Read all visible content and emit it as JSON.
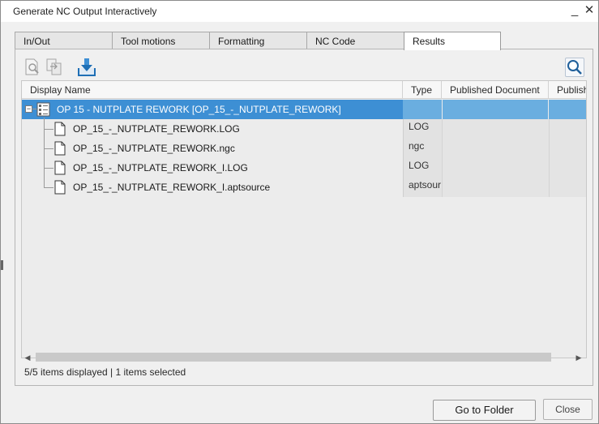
{
  "window": {
    "title": "Generate NC Output Interactively",
    "minimize_glyph": "_",
    "close_glyph": "✕"
  },
  "tabs": [
    {
      "label": "In/Out",
      "active": false
    },
    {
      "label": "Tool motions",
      "active": false
    },
    {
      "label": "Formatting",
      "active": false
    },
    {
      "label": "NC Code",
      "active": false
    },
    {
      "label": "Results",
      "active": true
    }
  ],
  "toolbar": {
    "icons": [
      "preview-document-icon",
      "compare-documents-icon",
      "save-download-icon",
      "search-icon"
    ]
  },
  "grid": {
    "columns": [
      "Display Name",
      "Type",
      "Published Document",
      "Publish"
    ],
    "root": {
      "label": "OP 15 - NUTPLATE REWORK [OP_15_-_NUTPLATE_REWORK]",
      "expand_glyph": "−",
      "selected": true
    },
    "rows": [
      {
        "name": "OP_15_-_NUTPLATE_REWORK.LOG",
        "type": "LOG"
      },
      {
        "name": "OP_15_-_NUTPLATE_REWORK.ngc",
        "type": "ngc"
      },
      {
        "name": "OP_15_-_NUTPLATE_REWORK_I.LOG",
        "type": "LOG"
      },
      {
        "name": "OP_15_-_NUTPLATE_REWORK_I.aptsource",
        "type": "aptsour"
      }
    ]
  },
  "scrollbar": {
    "left_arrow": "◀",
    "right_arrow": "▶"
  },
  "status": "5/5 items displayed | 1 items selected",
  "buttons": {
    "go_to_folder": "Go to Folder",
    "close": "Close"
  },
  "colors": {
    "selection": "#3d8fd4",
    "selection_light": "#6aaee0",
    "toolbar_accent": "#1f6fb5"
  }
}
